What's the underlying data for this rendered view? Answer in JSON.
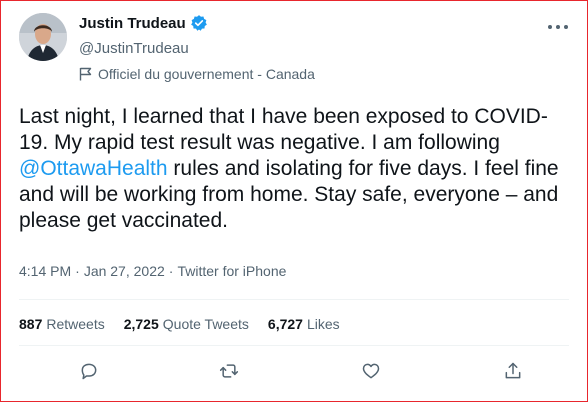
{
  "author": {
    "name": "Justin Trudeau",
    "handle": "@JustinTrudeau",
    "label": "Officiel du gouvernement - Canada",
    "verified_icon": "verified-badge-icon",
    "label_icon": "flag-icon"
  },
  "tweet": {
    "text_before": "Last night, I learned that I have been exposed to COVID-19. My rapid test result was negative. I am following ",
    "mention": "@OttawaHealth",
    "text_after": " rules and isolating for five days. I feel fine and will be working from home. Stay safe, everyone – and please get vaccinated."
  },
  "meta": {
    "time": "4:14 PM",
    "separator": "·",
    "date": "Jan 27, 2022",
    "source": "Twitter for iPhone"
  },
  "stats": {
    "retweets_count": "887",
    "retweets_label": "Retweets",
    "quotes_count": "2,725",
    "quotes_label": "Quote Tweets",
    "likes_count": "6,727",
    "likes_label": "Likes"
  },
  "colors": {
    "accent": "#1d9bf0",
    "text": "#0f1419",
    "secondary": "#536471",
    "border": "#e8262d"
  },
  "actions": [
    "reply-icon",
    "retweet-icon",
    "like-icon",
    "share-icon"
  ]
}
